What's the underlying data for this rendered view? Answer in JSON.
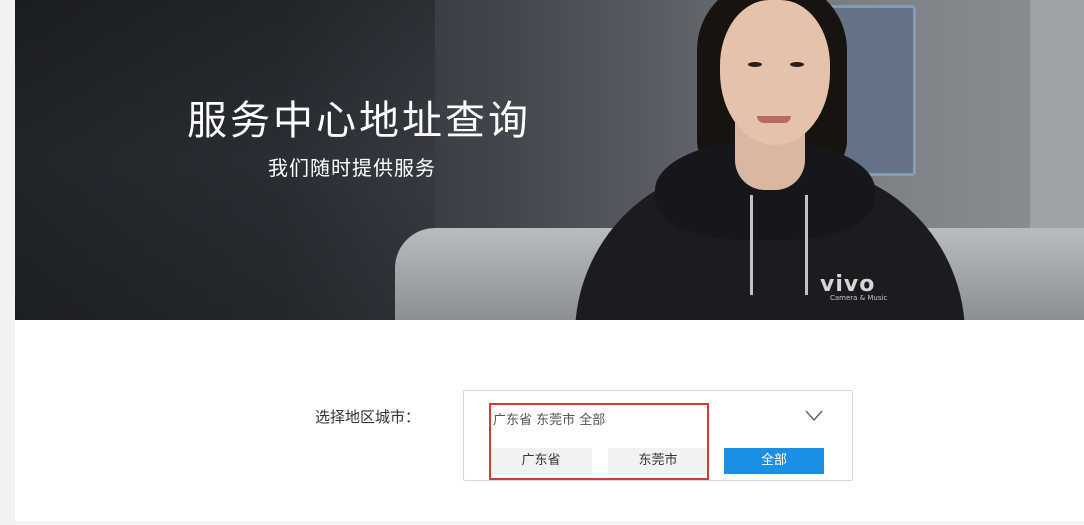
{
  "banner": {
    "title": "服务中心地址查询",
    "subtitle": "我们随时提供服务",
    "logo_text": "vivo",
    "logo_subtext": "Camera & Music"
  },
  "region_selector": {
    "label": "选择地区城市：",
    "selected_value": "广东省 东莞市 全部",
    "options": {
      "province": "广东省",
      "city": "东莞市",
      "district": "全部"
    },
    "active_option": "district",
    "active_color": "#1a8fe3",
    "highlight_color": "#d9383a"
  }
}
